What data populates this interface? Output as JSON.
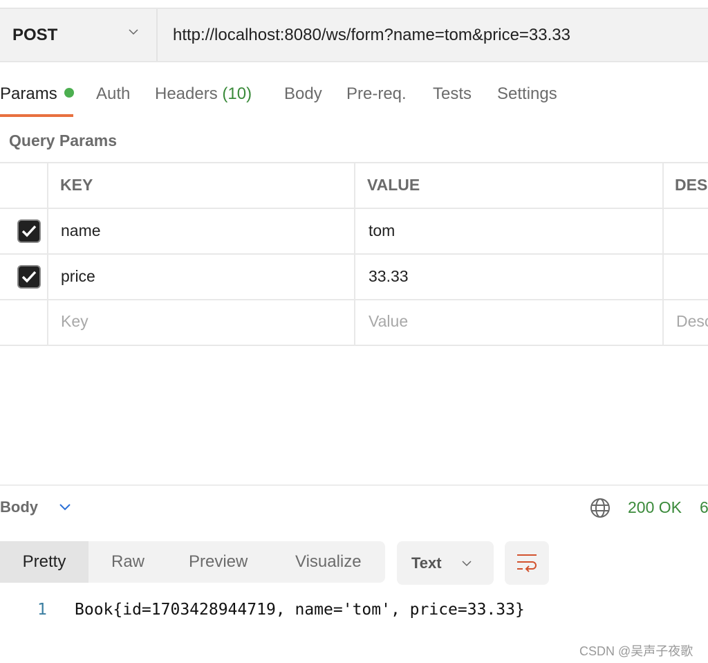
{
  "request": {
    "method": "POST",
    "url": "http://localhost:8080/ws/form?name=tom&price=33.33"
  },
  "tabs": [
    {
      "label": "Params",
      "active": true,
      "has_dot": true
    },
    {
      "label": "Auth"
    },
    {
      "label": "Headers",
      "count": "(10)"
    },
    {
      "label": "Body"
    },
    {
      "label": "Pre-req."
    },
    {
      "label": "Tests"
    },
    {
      "label": "Settings"
    }
  ],
  "query_params": {
    "title": "Query Params",
    "headers": [
      "KEY",
      "VALUE",
      "DES"
    ],
    "rows": [
      {
        "checked": true,
        "key": "name",
        "value": "tom"
      },
      {
        "checked": true,
        "key": "price",
        "value": "33.33"
      }
    ],
    "placeholders": {
      "key": "Key",
      "value": "Value",
      "desc": "Desc"
    }
  },
  "response": {
    "label": "Body",
    "status": "200 OK",
    "extra": "6",
    "view_tabs": [
      "Pretty",
      "Raw",
      "Preview",
      "Visualize"
    ],
    "active_view": "Pretty",
    "format": "Text",
    "lines": [
      {
        "num": "1",
        "text": "Book{id=1703428944719, name='tom', price=33.33}"
      }
    ]
  },
  "watermark": "CSDN @吴声子夜歌",
  "colors": {
    "accent": "#e8703f",
    "success": "#3a8a3a",
    "dot": "#4caf50"
  }
}
